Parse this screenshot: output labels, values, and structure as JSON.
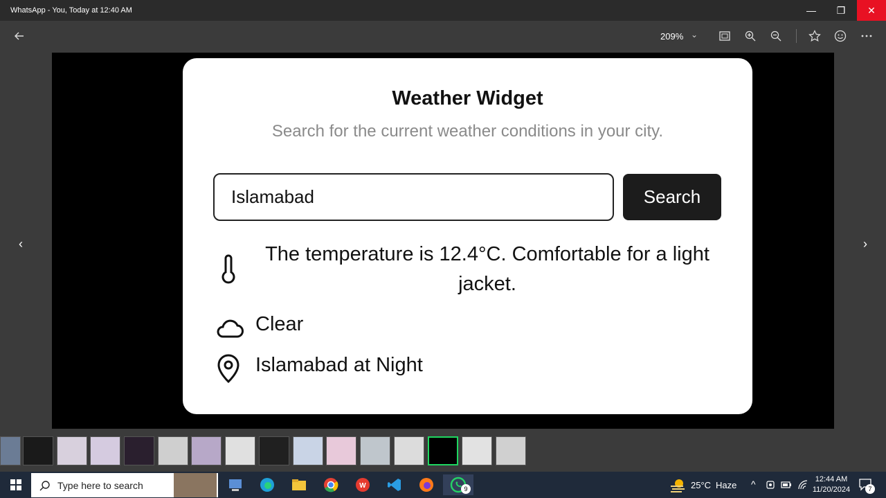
{
  "window": {
    "title": "WhatsApp - You, Today at 12:40 AM",
    "controls": {
      "minimize": "—",
      "maximize": "❐",
      "close": "✕"
    }
  },
  "toolbar": {
    "zoom_level": "209%",
    "icons": [
      "back-arrow-icon",
      "zoom-dropdown-chevron-icon",
      "fit-to-window-icon",
      "zoom-in-icon",
      "zoom-out-icon",
      "favorite-star-icon",
      "feedback-smile-icon",
      "more-options-icon"
    ]
  },
  "viewer": {
    "prev_arrow": "‹",
    "next_arrow": "›"
  },
  "widget": {
    "title": "Weather Widget",
    "subtitle": "Search for the current weather conditions in your city.",
    "input_value": "Islamabad",
    "search_label": "Search",
    "temperature_text": "The temperature is 12.4°C. Comfortable for a light jacket.",
    "condition_text": "Clear",
    "location_text": "Islamabad at Night"
  },
  "taskbar": {
    "search_placeholder": "Type here to search",
    "weather_temp": "25°C",
    "weather_desc": "Haze",
    "time": "12:44 AM",
    "date": "11/20/2024",
    "whatsapp_badge": "9",
    "notification_count": "7",
    "tray_chevron": "^"
  },
  "colors": {
    "titlebar": "#2b2b2b",
    "toolbar": "#3b3b3b",
    "close_button": "#e81123",
    "search_button": "#1c1c1c",
    "taskbar": "#1f2a3a",
    "active_thumb_border": "#1ed760"
  }
}
